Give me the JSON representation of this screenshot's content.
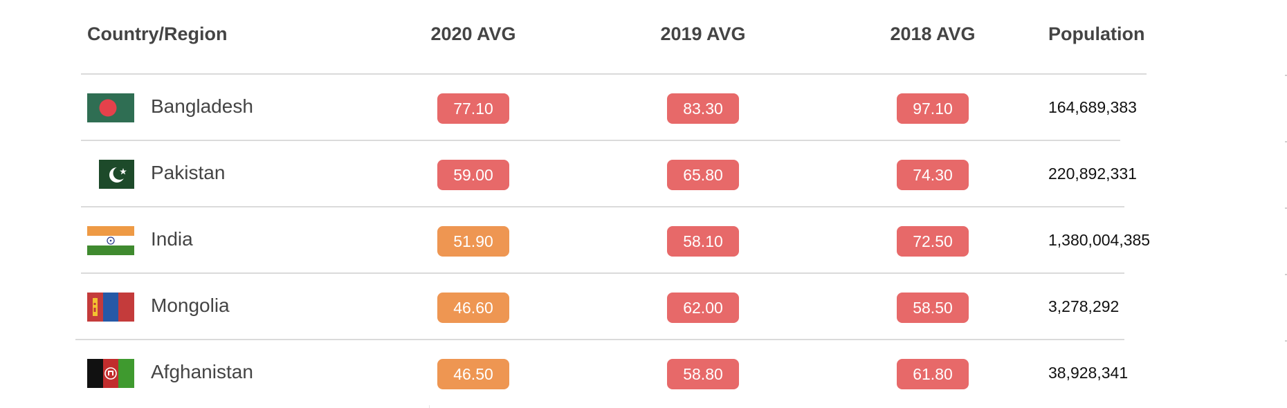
{
  "table": {
    "headers": {
      "country": "Country/Region",
      "avg2020": "2020 AVG",
      "avg2019": "2019 AVG",
      "avg2018": "2018 AVG",
      "population": "Population"
    },
    "rows": [
      {
        "country": "Bangladesh",
        "flag_icon": "bangladesh-flag-icon",
        "avg2020": "77.10",
        "avg2019": "83.30",
        "avg2018": "97.10",
        "population": "164,689,383"
      },
      {
        "country": "Pakistan",
        "flag_icon": "pakistan-flag-icon",
        "avg2020": "59.00",
        "avg2019": "65.80",
        "avg2018": "74.30",
        "population": "220,892,331"
      },
      {
        "country": "India",
        "flag_icon": "india-flag-icon",
        "avg2020": "51.90",
        "avg2019": "58.10",
        "avg2018": "72.50",
        "population": "1,380,004,385"
      },
      {
        "country": "Mongolia",
        "flag_icon": "mongolia-flag-icon",
        "avg2020": "46.60",
        "avg2019": "62.00",
        "avg2018": "58.50",
        "population": "3,278,292"
      },
      {
        "country": "Afghanistan",
        "flag_icon": "afghanistan-flag-icon",
        "avg2020": "46.50",
        "avg2019": "58.80",
        "avg2018": "61.80",
        "population": "38,928,341"
      }
    ]
  },
  "colors": {
    "badge_red": "#e76969",
    "badge_orange": "#ee9652",
    "header_text": "#444444",
    "divider": "#dadada"
  }
}
